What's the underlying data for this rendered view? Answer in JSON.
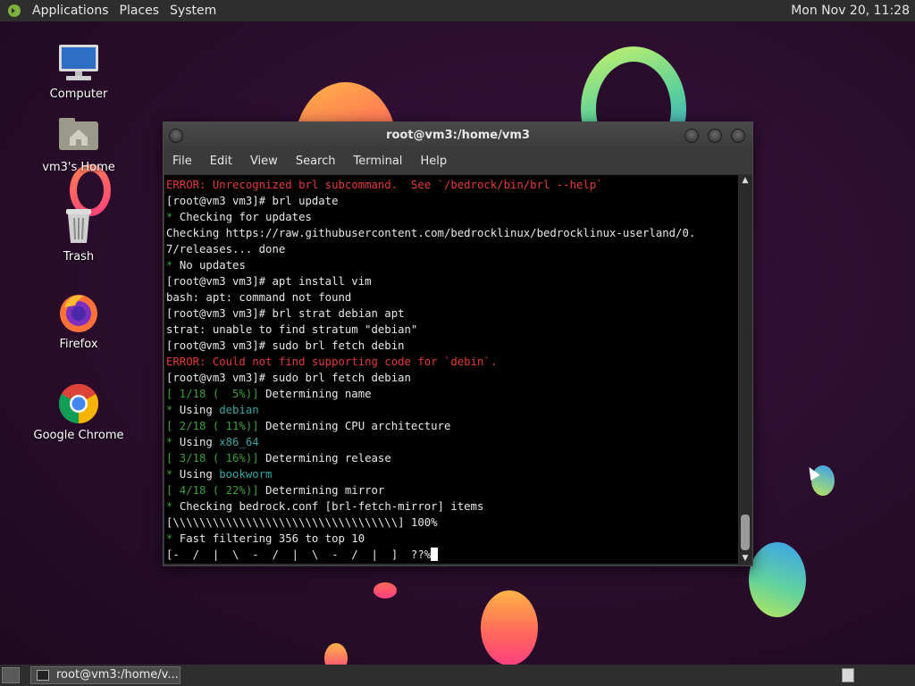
{
  "top_panel": {
    "menus": [
      "Applications",
      "Places",
      "System"
    ],
    "clock": "Mon Nov 20, 11:28"
  },
  "desktop_icons": [
    {
      "label": "Computer",
      "icon": "computer-icon"
    },
    {
      "label": "vm3's Home",
      "icon": "home-folder-icon"
    },
    {
      "label": "Trash",
      "icon": "trash-icon"
    },
    {
      "label": "Firefox",
      "icon": "firefox-icon"
    },
    {
      "label": "Google Chrome",
      "icon": "chrome-icon"
    }
  ],
  "window": {
    "title": "root@vm3:/home/vm3",
    "menu": [
      "File",
      "Edit",
      "View",
      "Search",
      "Terminal",
      "Help"
    ]
  },
  "terminal": {
    "lines": [
      [
        {
          "t": "ERROR: Unrecognized brl subcommand.  See `/bedrock/bin/brl --help`",
          "c": "red"
        }
      ],
      [
        {
          "t": "[root@vm3 vm3]# brl update",
          "c": ""
        }
      ],
      [
        {
          "t": "* ",
          "c": "green"
        },
        {
          "t": "Checking for updates",
          "c": ""
        }
      ],
      [
        {
          "t": "Checking https://raw.githubusercontent.com/bedrocklinux/bedrocklinux-userland/0.",
          "c": ""
        }
      ],
      [
        {
          "t": "7/releases... done",
          "c": ""
        }
      ],
      [
        {
          "t": "* ",
          "c": "green"
        },
        {
          "t": "No updates",
          "c": ""
        }
      ],
      [
        {
          "t": "[root@vm3 vm3]# apt install vim",
          "c": ""
        }
      ],
      [
        {
          "t": "bash: apt: command not found",
          "c": ""
        }
      ],
      [
        {
          "t": "[root@vm3 vm3]# brl strat debian apt",
          "c": ""
        }
      ],
      [
        {
          "t": "strat: unable to find stratum \"debian\"",
          "c": ""
        }
      ],
      [
        {
          "t": "[root@vm3 vm3]# sudo brl fetch debin",
          "c": ""
        }
      ],
      [
        {
          "t": "ERROR: Could not find supporting code for `debin`.",
          "c": "red"
        }
      ],
      [
        {
          "t": "[root@vm3 vm3]# sudo brl fetch debian",
          "c": ""
        }
      ],
      [
        {
          "t": "[ 1/18 (  5%)] ",
          "c": "green"
        },
        {
          "t": "Determining name",
          "c": ""
        }
      ],
      [
        {
          "t": "* ",
          "c": "green"
        },
        {
          "t": "Using ",
          "c": ""
        },
        {
          "t": "debian",
          "c": "cyan"
        }
      ],
      [
        {
          "t": "[ 2/18 ( 11%)] ",
          "c": "green"
        },
        {
          "t": "Determining CPU architecture",
          "c": ""
        }
      ],
      [
        {
          "t": "* ",
          "c": "green"
        },
        {
          "t": "Using ",
          "c": ""
        },
        {
          "t": "x86_64",
          "c": "cyan"
        }
      ],
      [
        {
          "t": "[ 3/18 ( 16%)] ",
          "c": "green"
        },
        {
          "t": "Determining release",
          "c": ""
        }
      ],
      [
        {
          "t": "* ",
          "c": "green"
        },
        {
          "t": "Using ",
          "c": ""
        },
        {
          "t": "bookworm",
          "c": "cyan"
        }
      ],
      [
        {
          "t": "[ 4/18 ( 22%)] ",
          "c": "green"
        },
        {
          "t": "Determining mirror",
          "c": ""
        }
      ],
      [
        {
          "t": "* ",
          "c": "green"
        },
        {
          "t": "Checking bedrock.conf [brl-fetch-mirror] items",
          "c": ""
        }
      ],
      [
        {
          "t": "[\\\\\\\\\\\\\\\\\\\\\\\\\\\\\\\\\\\\\\\\\\\\\\\\\\\\\\\\\\\\\\\\\\\\] 100%",
          "c": ""
        }
      ],
      [
        {
          "t": "* ",
          "c": "green"
        },
        {
          "t": "Fast filtering 356 to top 10",
          "c": ""
        }
      ],
      [
        {
          "t": "[-  /  |  \\  -  /  |  \\  -  /  |  ]  ??%",
          "c": ""
        }
      ]
    ]
  },
  "taskbar": {
    "task_label": "root@vm3:/home/v..."
  }
}
